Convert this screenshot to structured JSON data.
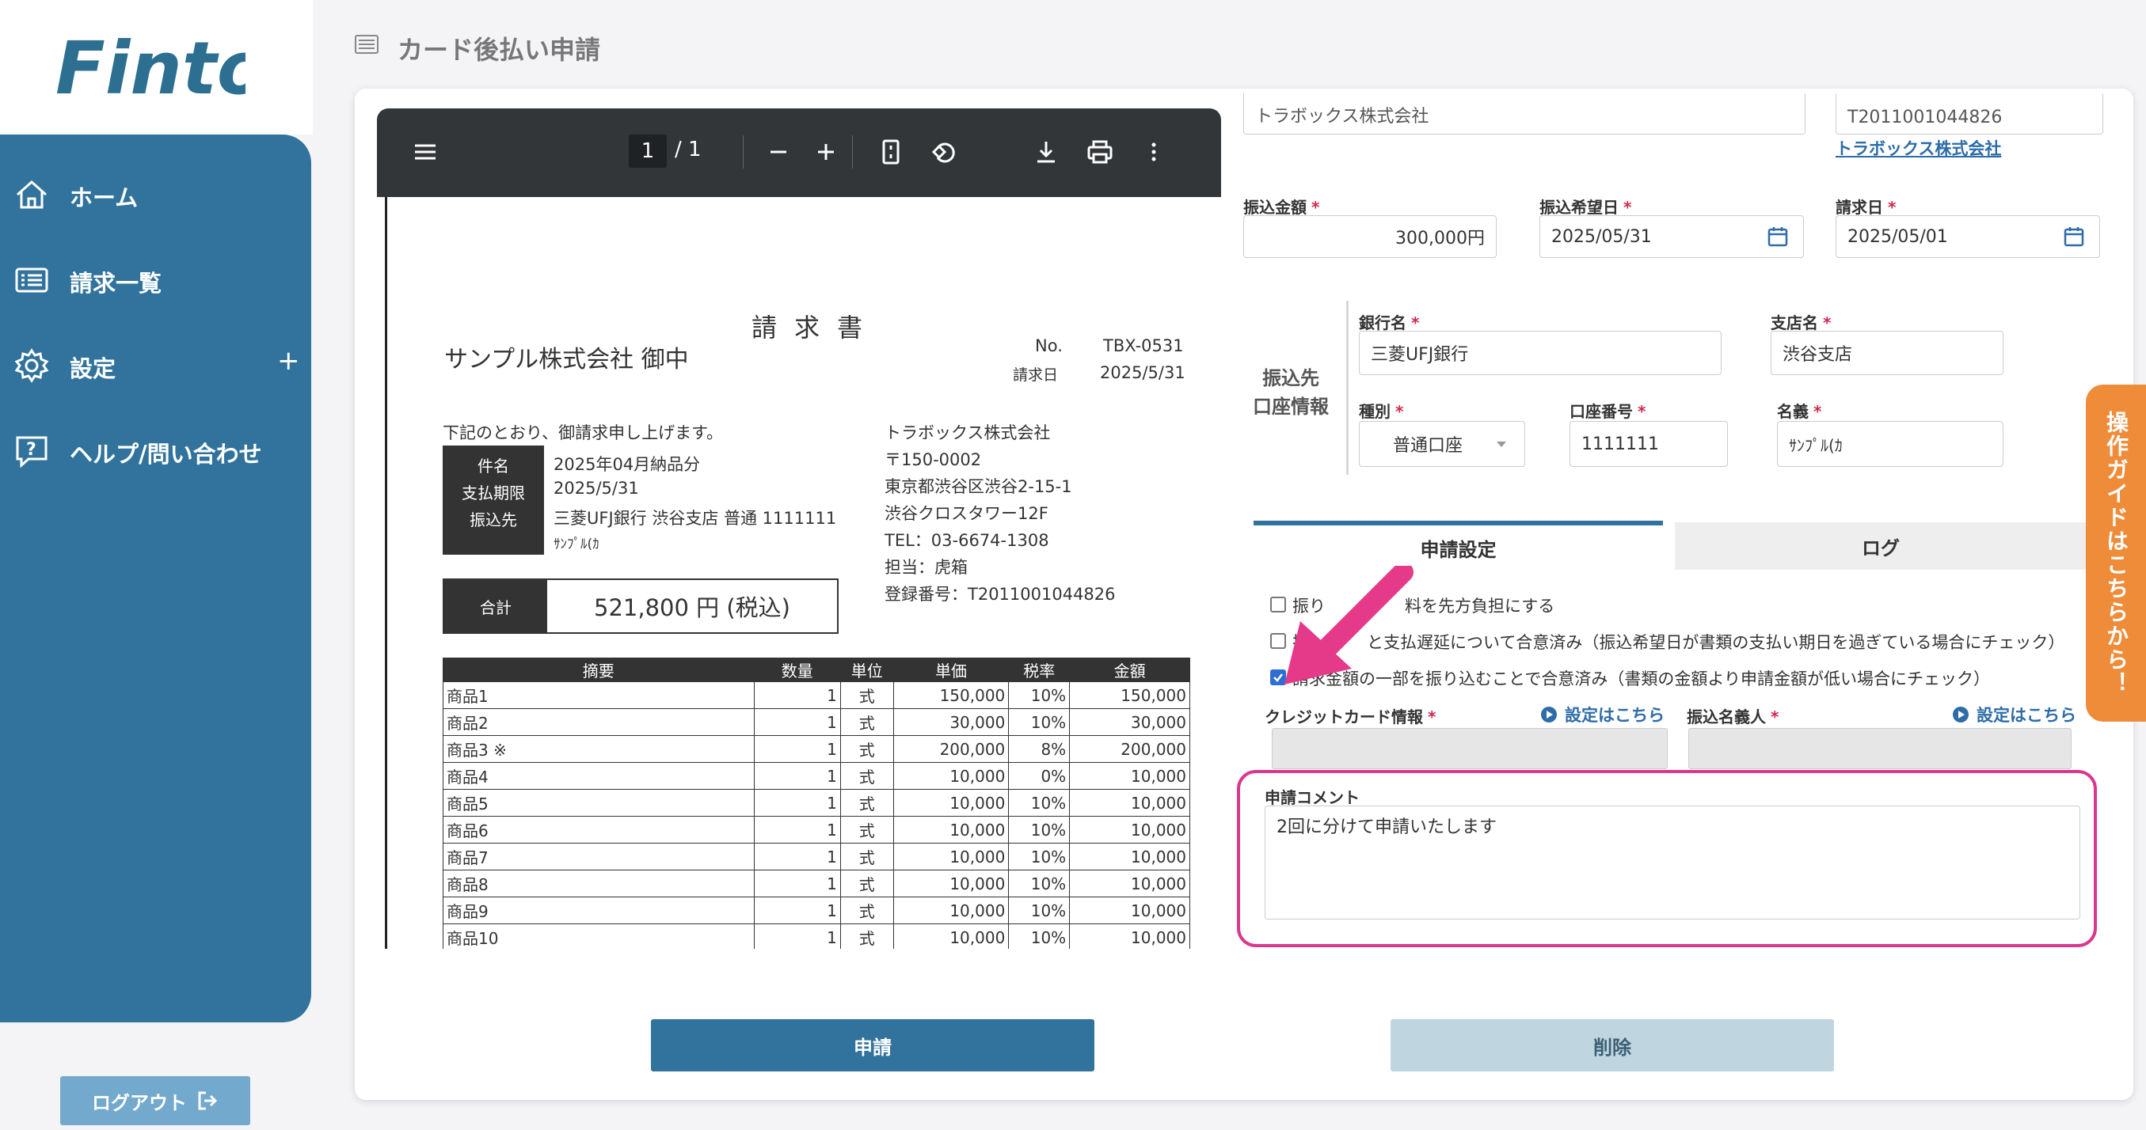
{
  "app": {
    "logo_text": "Finto",
    "page_title": "カード後払い申請"
  },
  "sidebar": {
    "items": [
      {
        "label": "ホーム",
        "icon": "home-icon"
      },
      {
        "label": "請求一覧",
        "icon": "list-icon"
      },
      {
        "label": "設定",
        "icon": "gear-icon",
        "expand": "+"
      },
      {
        "label": "ヘルプ/問い合わせ",
        "icon": "help-icon"
      }
    ],
    "logout_label": "ログアウト"
  },
  "pdf_viewer": {
    "current_page": "1",
    "total_pages": "/ 1",
    "invoice": {
      "title": "請求書",
      "to": "サンプル株式会社 御中",
      "no_label": "No.",
      "no_value": "TBX-0531",
      "date_label": "請求日",
      "date_value": "2025/5/31",
      "intro": "下記のとおり、御請求申し上げます。",
      "info": [
        {
          "label": "件名",
          "value": "2025年04月納品分"
        },
        {
          "label": "支払期限",
          "value": "2025/5/31"
        },
        {
          "label": "振込先",
          "value": "三菱UFJ銀行 渋谷支店 普通 1111111"
        }
      ],
      "info_extra": "ｻﾝﾌﾟﾙ(ｶ",
      "issuer": [
        "トラボックス株式会社",
        "〒150-0002",
        "東京都渋谷区渋谷2-15-1",
        "渋谷クロスタワー12F",
        "TEL：03-6674-1308",
        "担当：虎箱",
        "登録番号：T2011001044826"
      ],
      "total_label": "合計",
      "total_value": "521,800 円 (税込)",
      "columns": [
        "摘要",
        "数量",
        "単位",
        "単価",
        "税率",
        "金額"
      ],
      "rows": [
        [
          "商品1",
          "1",
          "式",
          "150,000",
          "10%",
          "150,000"
        ],
        [
          "商品2",
          "1",
          "式",
          "30,000",
          "10%",
          "30,000"
        ],
        [
          "商品3 ※",
          "1",
          "式",
          "200,000",
          "8%",
          "200,000"
        ],
        [
          "商品4",
          "1",
          "式",
          "10,000",
          "0%",
          "10,000"
        ],
        [
          "商品5",
          "1",
          "式",
          "10,000",
          "10%",
          "10,000"
        ],
        [
          "商品6",
          "1",
          "式",
          "10,000",
          "10%",
          "10,000"
        ],
        [
          "商品7",
          "1",
          "式",
          "10,000",
          "10%",
          "10,000"
        ],
        [
          "商品8",
          "1",
          "式",
          "10,000",
          "10%",
          "10,000"
        ],
        [
          "商品9",
          "1",
          "式",
          "10,000",
          "10%",
          "10,000"
        ],
        [
          "商品10",
          "1",
          "式",
          "10,000",
          "10%",
          "10,000"
        ]
      ]
    }
  },
  "form": {
    "payee_value": "トラボックス株式会社",
    "reg_number_value": "T2011001044826",
    "reg_company_link": "トラボックス株式会社",
    "amount_label": "振込金額",
    "amount_value": "300,000円",
    "desired_date_label": "振込希望日",
    "desired_date_value": "2025/05/31",
    "invoice_date_label": "請求日",
    "invoice_date_value": "2025/05/01",
    "account_section_label": "振込先\n口座情報",
    "bank_label": "銀行名",
    "bank_value": "三菱UFJ銀行",
    "branch_label": "支店名",
    "branch_value": "渋谷支店",
    "type_label": "種別",
    "type_value": "普通口座",
    "account_no_label": "口座番号",
    "account_no_value": "1111111",
    "holder_label": "名義",
    "holder_value": "ｻﾝﾌﾟﾙ(ｶ",
    "required_mark": "*"
  },
  "tabs": [
    {
      "label": "申請設定",
      "active": true
    },
    {
      "label": "ログ",
      "active": false
    }
  ],
  "settings": {
    "checkboxes": [
      {
        "label": "振り込み手数料を先方負担にする",
        "checked": false,
        "visible_text_a": "振り",
        "visible_text_b": "料を先方負担にする"
      },
      {
        "label": "と支払遅延について合意済み（振込希望日が書類の支払い期日を過ぎている場合にチェック）",
        "checked": false,
        "visible_text_a": "振"
      },
      {
        "label": "請求金額の一部を振り込むことで合意済み（書類の金額より申請金額が低い場合にチェック）",
        "checked": true
      }
    ],
    "credit_card_label": "クレジットカード情報",
    "transfer_name_label": "振込名義人",
    "setting_link_label": "設定はこちら",
    "comment_label": "申請コメント",
    "comment_value": "2回に分けて申請いたします"
  },
  "buttons": {
    "apply": "申請",
    "delete": "削除"
  },
  "guide_tab": "操作ガイドはこちらから！",
  "colors": {
    "primary": "#31739c",
    "highlight": "#d9388e",
    "guide": "#ee8c3a",
    "required": "#d0284e"
  }
}
